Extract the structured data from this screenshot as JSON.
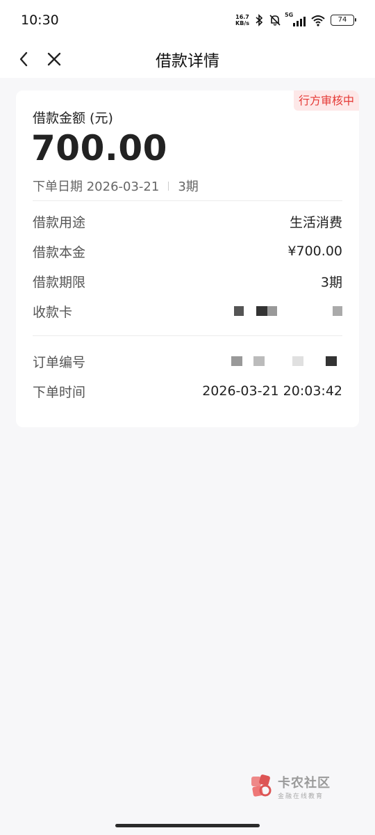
{
  "status_bar": {
    "time": "10:30",
    "net_speed_top": "16.7",
    "net_speed_bottom": "KB/s",
    "network_type": "5G",
    "battery": "74"
  },
  "nav": {
    "title": "借款详情"
  },
  "card": {
    "status_tag": "行方审核中",
    "amount_label": "借款金额 (元)",
    "amount_value": "700.00",
    "order_date": "下单日期 2026-03-21",
    "term_short": "3期",
    "details": [
      {
        "label": "借款用途",
        "value": "生活消费"
      },
      {
        "label": "借款本金",
        "value": "¥700.00"
      },
      {
        "label": "借款期限",
        "value": "3期"
      },
      {
        "label": "收款卡",
        "value": ""
      }
    ],
    "order": [
      {
        "label": "订单编号",
        "value": ""
      },
      {
        "label": "下单时间",
        "value": "2026-03-21 20:03:42"
      }
    ]
  },
  "watermark": {
    "main": "卡农社区",
    "sub": "金融在线教育"
  },
  "colors": {
    "accent_red": "#e53935",
    "tag_bg": "#fde8e8",
    "page_bg": "#f7f7f9"
  }
}
